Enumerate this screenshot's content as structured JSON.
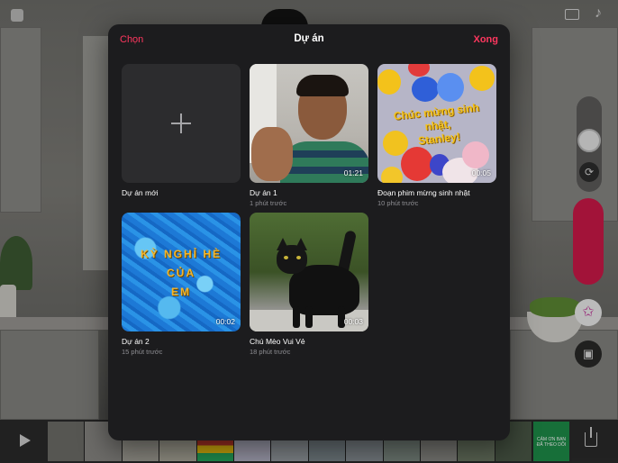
{
  "colors": {
    "accent": "#ff375f",
    "modal_bg": "#1c1c1e",
    "tile_bg": "#2c2c2e",
    "secondary_text": "#8e8e93",
    "record": "#d0194a"
  },
  "modal": {
    "select_label": "Chọn",
    "title": "Dự án",
    "done_label": "Xong"
  },
  "new_project": {
    "label": "Dự án mới",
    "icon": "plus-icon"
  },
  "projects": [
    {
      "name": "Dự án 1",
      "meta": "1 phút trước",
      "duration": "01:21"
    },
    {
      "name": "Đoạn phim mừng sinh nhật",
      "meta": "10 phút trước",
      "duration": "00:05",
      "thumb_text": [
        "Chúc mừng sinh nhật,",
        "Stanley!"
      ]
    },
    {
      "name": "Dự án 2",
      "meta": "15 phút trước",
      "duration": "00:02",
      "thumb_text": [
        "KỲ NGHỈ HÈ",
        "CỦA",
        "EM"
      ]
    },
    {
      "name": "Chú Mèo Vui Vẻ",
      "meta": "18 phút trước",
      "duration": "00:03"
    }
  ],
  "camera_controls": {
    "aspect_icon": "aspect-ratio-icon",
    "music_icon": "music-note-icon",
    "flip_icon": "camera-flip-icon",
    "effects_icon": "star-effects-icon",
    "media_icon": "photo-library-icon",
    "share_icon": "share-icon",
    "play_icon": "play-icon"
  },
  "timeline": {
    "end_thumb_text": "CẢM ƠN BẠN ĐÃ THEO DÕI"
  }
}
